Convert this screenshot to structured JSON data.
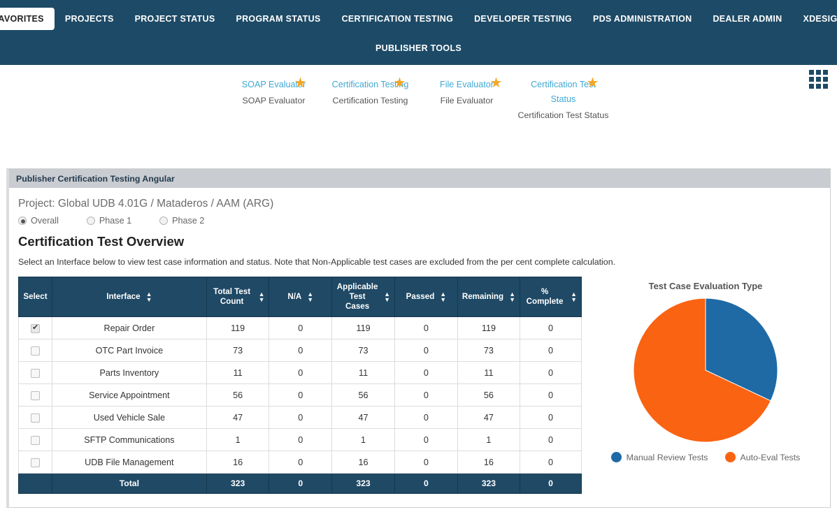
{
  "nav": {
    "row1": [
      {
        "label": "FAVORITES",
        "active": true
      },
      {
        "label": "PROJECTS",
        "active": false
      },
      {
        "label": "PROJECT STATUS",
        "active": false
      },
      {
        "label": "PROGRAM STATUS",
        "active": false
      },
      {
        "label": "CERTIFICATION TESTING",
        "active": false
      },
      {
        "label": "DEVELOPER TESTING",
        "active": false
      },
      {
        "label": "PDS ADMINISTRATION",
        "active": false
      },
      {
        "label": "DEALER ADMIN",
        "active": false
      },
      {
        "label": "XDESIGN",
        "active": false
      }
    ],
    "row2": [
      {
        "label": "PUBLISHER TOOLS",
        "active": false
      }
    ]
  },
  "shortcuts": {
    "apps_icon": "apps-grid-icon",
    "items": [
      {
        "title": "SOAP Evaluator",
        "sub": "SOAP Evaluator",
        "star": "★"
      },
      {
        "title": "Certification Testing",
        "sub": "Certification Testing",
        "star": "★"
      },
      {
        "title": "File Evaluator",
        "sub": "File Evaluator",
        "star": "★"
      },
      {
        "title": "Certification Test Status",
        "sub": "Certification Test Status",
        "star": "★"
      }
    ]
  },
  "panel": {
    "header": "Publisher Certification Testing Angular",
    "project_line": "Project: Global UDB 4.01G / Mataderos / AAM (ARG)",
    "phase_options": [
      {
        "label": "Overall",
        "selected": true
      },
      {
        "label": "Phase 1",
        "selected": false
      },
      {
        "label": "Phase 2",
        "selected": false
      }
    ],
    "overview_title": "Certification Test Overview",
    "hint": "Select an Interface below to view test case information and status. Note that Non-Applicable test cases are excluded from the per cent complete calculation."
  },
  "table": {
    "columns": [
      {
        "label": "Select",
        "sortable": false
      },
      {
        "label": "Interface",
        "sortable": true
      },
      {
        "label": "Total Test Count",
        "sortable": true
      },
      {
        "label": "N/A",
        "sortable": true
      },
      {
        "label": "Applicable Test Cases",
        "sortable": true
      },
      {
        "label": "Passed",
        "sortable": true
      },
      {
        "label": "Remaining",
        "sortable": true
      },
      {
        "label": "% Complete",
        "sortable": true
      }
    ],
    "rows": [
      {
        "selected": true,
        "interface": "Repair Order",
        "total": "119",
        "na": "0",
        "applicable": "119",
        "passed": "0",
        "remaining": "119",
        "pct": "0"
      },
      {
        "selected": false,
        "interface": "OTC Part Invoice",
        "total": "73",
        "na": "0",
        "applicable": "73",
        "passed": "0",
        "remaining": "73",
        "pct": "0"
      },
      {
        "selected": false,
        "interface": "Parts Inventory",
        "total": "11",
        "na": "0",
        "applicable": "11",
        "passed": "0",
        "remaining": "11",
        "pct": "0"
      },
      {
        "selected": false,
        "interface": "Service Appointment",
        "total": "56",
        "na": "0",
        "applicable": "56",
        "passed": "0",
        "remaining": "56",
        "pct": "0"
      },
      {
        "selected": false,
        "interface": "Used Vehicle Sale",
        "total": "47",
        "na": "0",
        "applicable": "47",
        "passed": "0",
        "remaining": "47",
        "pct": "0"
      },
      {
        "selected": false,
        "interface": "SFTP Communications",
        "total": "1",
        "na": "0",
        "applicable": "1",
        "passed": "0",
        "remaining": "1",
        "pct": "0"
      },
      {
        "selected": false,
        "interface": "UDB File Management",
        "total": "16",
        "na": "0",
        "applicable": "16",
        "passed": "0",
        "remaining": "16",
        "pct": "0"
      }
    ],
    "total_row": {
      "label": "Total",
      "total": "323",
      "na": "0",
      "applicable": "323",
      "passed": "0",
      "remaining": "323",
      "pct": "0"
    }
  },
  "chart_data": {
    "type": "pie",
    "title": "Test Case Evaluation Type",
    "labels": [
      "Manual Review Tests",
      "Auto-Eval Tests"
    ],
    "values": [
      32,
      68
    ],
    "colors": [
      "#1f6aa5",
      "#fa6312"
    ],
    "legend_position": "bottom",
    "start_angle_deg": 0,
    "direction": "clockwise"
  },
  "colors": {
    "navbar": "#1d4a66",
    "table_header": "#1f4965",
    "panel_header": "#c9ccd1",
    "link": "#3fa8d4",
    "star": "#f5a623",
    "pie_blue": "#1f6aa5",
    "pie_orange": "#fa6312"
  }
}
